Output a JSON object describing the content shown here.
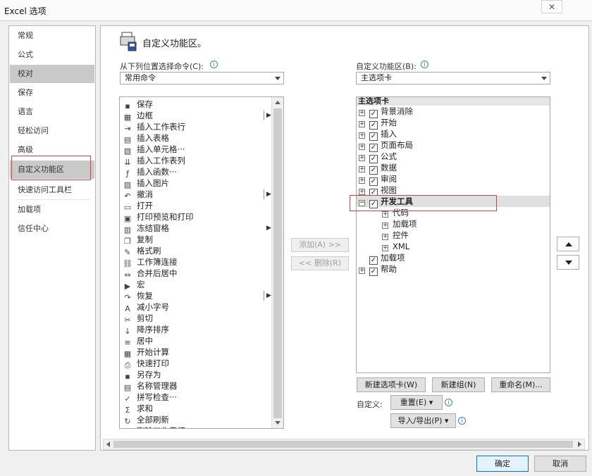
{
  "window": {
    "title": "Excel 选项",
    "close_label": "✕"
  },
  "nav": {
    "items": [
      "常规",
      "公式",
      "校对",
      "保存",
      "语言",
      "轻松访问",
      "高级",
      "自定义功能区",
      "快速访问工具栏",
      "加载项",
      "信任中心"
    ]
  },
  "header": {
    "title": "自定义功能区。"
  },
  "commands_from": {
    "label": "从下列位置选择命令(C):",
    "value": "常用命令"
  },
  "commands": [
    "保存",
    "边框",
    "插入工作表行",
    "插入表格",
    "插入单元格···",
    "插入工作表列",
    "插入函数···",
    "插入图片",
    "撤消",
    "打开",
    "打印预览和打印",
    "冻结窗格",
    "复制",
    "格式刷",
    "工作簿连接",
    "合并后居中",
    "宏",
    "恢复",
    "减小字号",
    "剪切",
    "降序排序",
    "居中",
    "开始计算",
    "快速打印",
    "另存为",
    "名称管理器",
    "拼写检查···",
    "求和",
    "全部刷新",
    "删除工作表行"
  ],
  "command_icons": [
    "save-icon",
    "border-icon",
    "insert-row-icon",
    "insert-table-icon",
    "insert-cells-icon",
    "insert-column-icon",
    "function-icon",
    "picture-icon",
    "undo-icon",
    "open-folder-icon",
    "print-preview-icon",
    "freeze-panes-icon",
    "copy-icon",
    "format-painter-icon",
    "connections-icon",
    "merge-center-icon",
    "macro-icon",
    "redo-icon",
    "decrease-font-icon",
    "cut-icon",
    "sort-descending-icon",
    "center-align-icon",
    "calculate-icon",
    "quick-print-icon",
    "save-as-icon",
    "name-manager-icon",
    "spelling-icon",
    "sum-icon",
    "refresh-all-icon",
    "delete-row-icon"
  ],
  "ribbon": {
    "label": "自定义功能区(B):",
    "value": "主选项卡",
    "tree_header": "主选项卡"
  },
  "tree": [
    {
      "label": "背景消除",
      "expander": "+",
      "checked": true
    },
    {
      "label": "开始",
      "expander": "+",
      "checked": true
    },
    {
      "label": "插入",
      "expander": "+",
      "checked": true
    },
    {
      "label": "页面布局",
      "expander": "+",
      "checked": true
    },
    {
      "label": "公式",
      "expander": "+",
      "checked": true
    },
    {
      "label": "数据",
      "expander": "+",
      "checked": true
    },
    {
      "label": "审阅",
      "expander": "+",
      "checked": true
    },
    {
      "label": "视图",
      "expander": "+",
      "checked": true
    },
    {
      "label": "开发工具",
      "expander": "−",
      "checked": true
    },
    {
      "label": "代码",
      "expander": "+"
    },
    {
      "label": "加载项",
      "expander": "+"
    },
    {
      "label": "控件",
      "expander": "+"
    },
    {
      "label": "XML",
      "expander": "+"
    },
    {
      "label": "加载项",
      "expander": "",
      "checked": true
    },
    {
      "label": "帮助",
      "expander": "+",
      "checked": true
    }
  ],
  "buttons": {
    "add": "添加(A) >>",
    "remove": "<< 删除(R)",
    "new_tab": "新建选项卡(W)",
    "new_group": "新建组(N)",
    "rename": "重命名(M)...",
    "customize_label": "自定义:",
    "reset": "重置(E) ▾",
    "import_export": "导入/导出(P) ▾",
    "ok": "确定",
    "cancel": "取消"
  },
  "colors": {
    "highlight_red": "#d84040",
    "selection_gray": "#c9c9c9"
  }
}
